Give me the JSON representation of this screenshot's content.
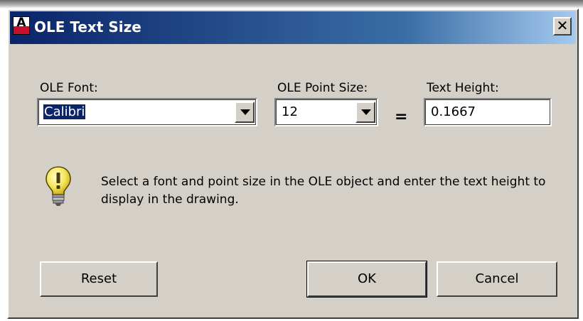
{
  "window": {
    "title": "OLE Text Size",
    "close_label": "✕",
    "app_icon_letter": "A"
  },
  "fields": {
    "font_label": "OLE Font:",
    "font_value": "Calibri",
    "point_size_label": "OLE Point Size:",
    "point_size_value": "12",
    "equals": "=",
    "text_height_label": "Text Height:",
    "text_height_value": "0.1667"
  },
  "info": {
    "icon": "lightbulb-icon",
    "text": "Select a font and point size in the OLE object and enter the text height to display in the drawing."
  },
  "buttons": {
    "reset": "Reset",
    "ok": "OK",
    "cancel": "Cancel"
  },
  "colors": {
    "titlebar_start": "#0a246a",
    "titlebar_end": "#a6caf0",
    "dialog_bg": "#d4d0c8",
    "selection": "#0a246a"
  }
}
